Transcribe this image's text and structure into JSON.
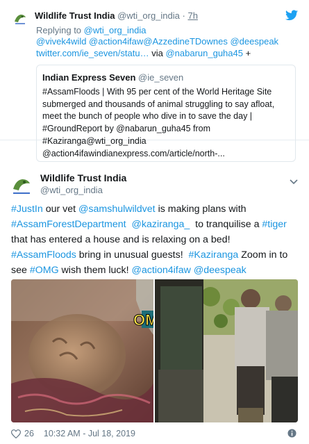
{
  "reply_tweet": {
    "author_name": "Wildlife Trust India",
    "author_handle": "@wti_org_india",
    "separator": "·",
    "time": "7h",
    "replying_prefix": "Replying to",
    "replying_to": "@wti_org_india",
    "mentions": "@vivek4wild @action4ifaw@AzzedineTDownes @deespeak",
    "short_link": "twitter.com/ie_seven/statu…",
    "via_text": "via",
    "via_user": "@nabarun_guha45",
    "plus": "+"
  },
  "quoted_tweet": {
    "name": "Indian Express Seven",
    "handle": "@ie_seven",
    "lines": [
      "#AssamFloods | With 95 per cent of the World Heritage Site",
      "submerged and thousands of animal struggling to say afloat,",
      "meet the bunch of people who dive in to save the day |",
      "#GroundReport by @nabarun_guha45 from",
      "#Kaziranga@wti_org_india",
      "@action4ifawindianexpress.com/article/north-..."
    ]
  },
  "main_tweet": {
    "author_name": "Wildlife Trust India",
    "author_handle": "@wti_org_india",
    "line1": {
      "a": "#JustIn",
      "b": " our vet ",
      "c": "@samshulwildvet",
      "d": " is making plans with"
    },
    "line2": {
      "a": "#AssamForestDepartment",
      "b": "  ",
      "c": "@kaziranga_",
      "d": "  to tranquilise a ",
      "e": "#tiger"
    },
    "line3": {
      "a": "that has entered a house and is relaxing on a bed!"
    },
    "line4": {
      "a": "#AssamFloods",
      "b": " bring in unusual guests!  ",
      "c": "#Kaziranga",
      "d": " Zoom in to"
    },
    "line5": {
      "a": "see ",
      "b": "#OMG",
      "c": " wish them luck! ",
      "d": "@action4ifaw",
      "e": " ",
      "f": "@deespeak"
    },
    "photo_overlay_text": "OM",
    "like_count": "26",
    "timestamp": "10:32 AM - Jul 18, 2019"
  },
  "icons": {
    "avatar": "wti-logo-avatar",
    "brand": "twitter-bird-icon",
    "menu": "chevron-down-icon",
    "like": "heart-icon",
    "info": "info-icon"
  },
  "colors": {
    "link": "#1b95e0",
    "muted": "#657786",
    "text": "#14171a",
    "border": "#e1e8ed"
  }
}
